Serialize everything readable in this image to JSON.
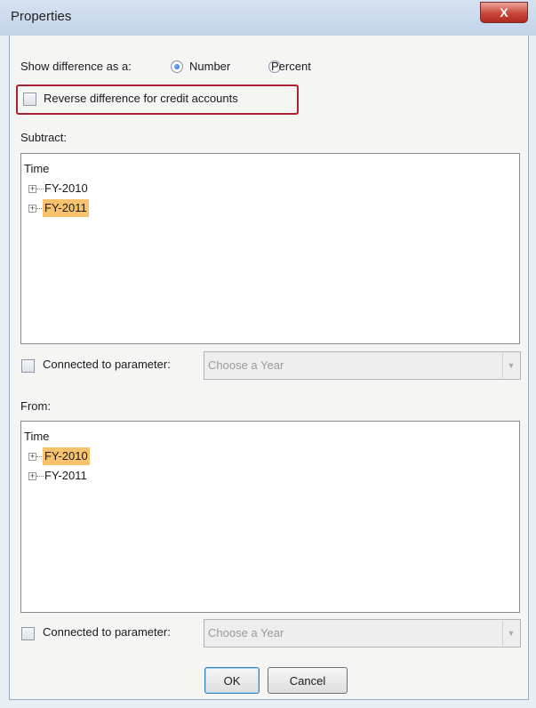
{
  "window": {
    "title": "Properties",
    "close_glyph": "X"
  },
  "difference": {
    "label": "Show difference as a:",
    "options": [
      {
        "label": "Number",
        "selected": true
      },
      {
        "label": "Percent",
        "selected": false
      }
    ]
  },
  "reverse_credit": {
    "label": "Reverse difference for credit accounts",
    "checked": false
  },
  "subtract": {
    "label": "Subtract:",
    "tree_root": "Time",
    "items": [
      {
        "label": "FY-2010",
        "selected": false
      },
      {
        "label": "FY-2011",
        "selected": true
      }
    ],
    "connected_label": "Connected to parameter:",
    "connected_checked": false,
    "param_placeholder": "Choose a Year"
  },
  "from": {
    "label": "From:",
    "tree_root": "Time",
    "items": [
      {
        "label": "FY-2010",
        "selected": true
      },
      {
        "label": "FY-2011",
        "selected": false
      }
    ],
    "connected_label": "Connected to parameter:",
    "connected_checked": false,
    "param_placeholder": "Choose a Year"
  },
  "buttons": {
    "ok": "OK",
    "cancel": "Cancel"
  },
  "colors": {
    "selection": "#f7c26b",
    "highlight_border": "#a7232c"
  }
}
